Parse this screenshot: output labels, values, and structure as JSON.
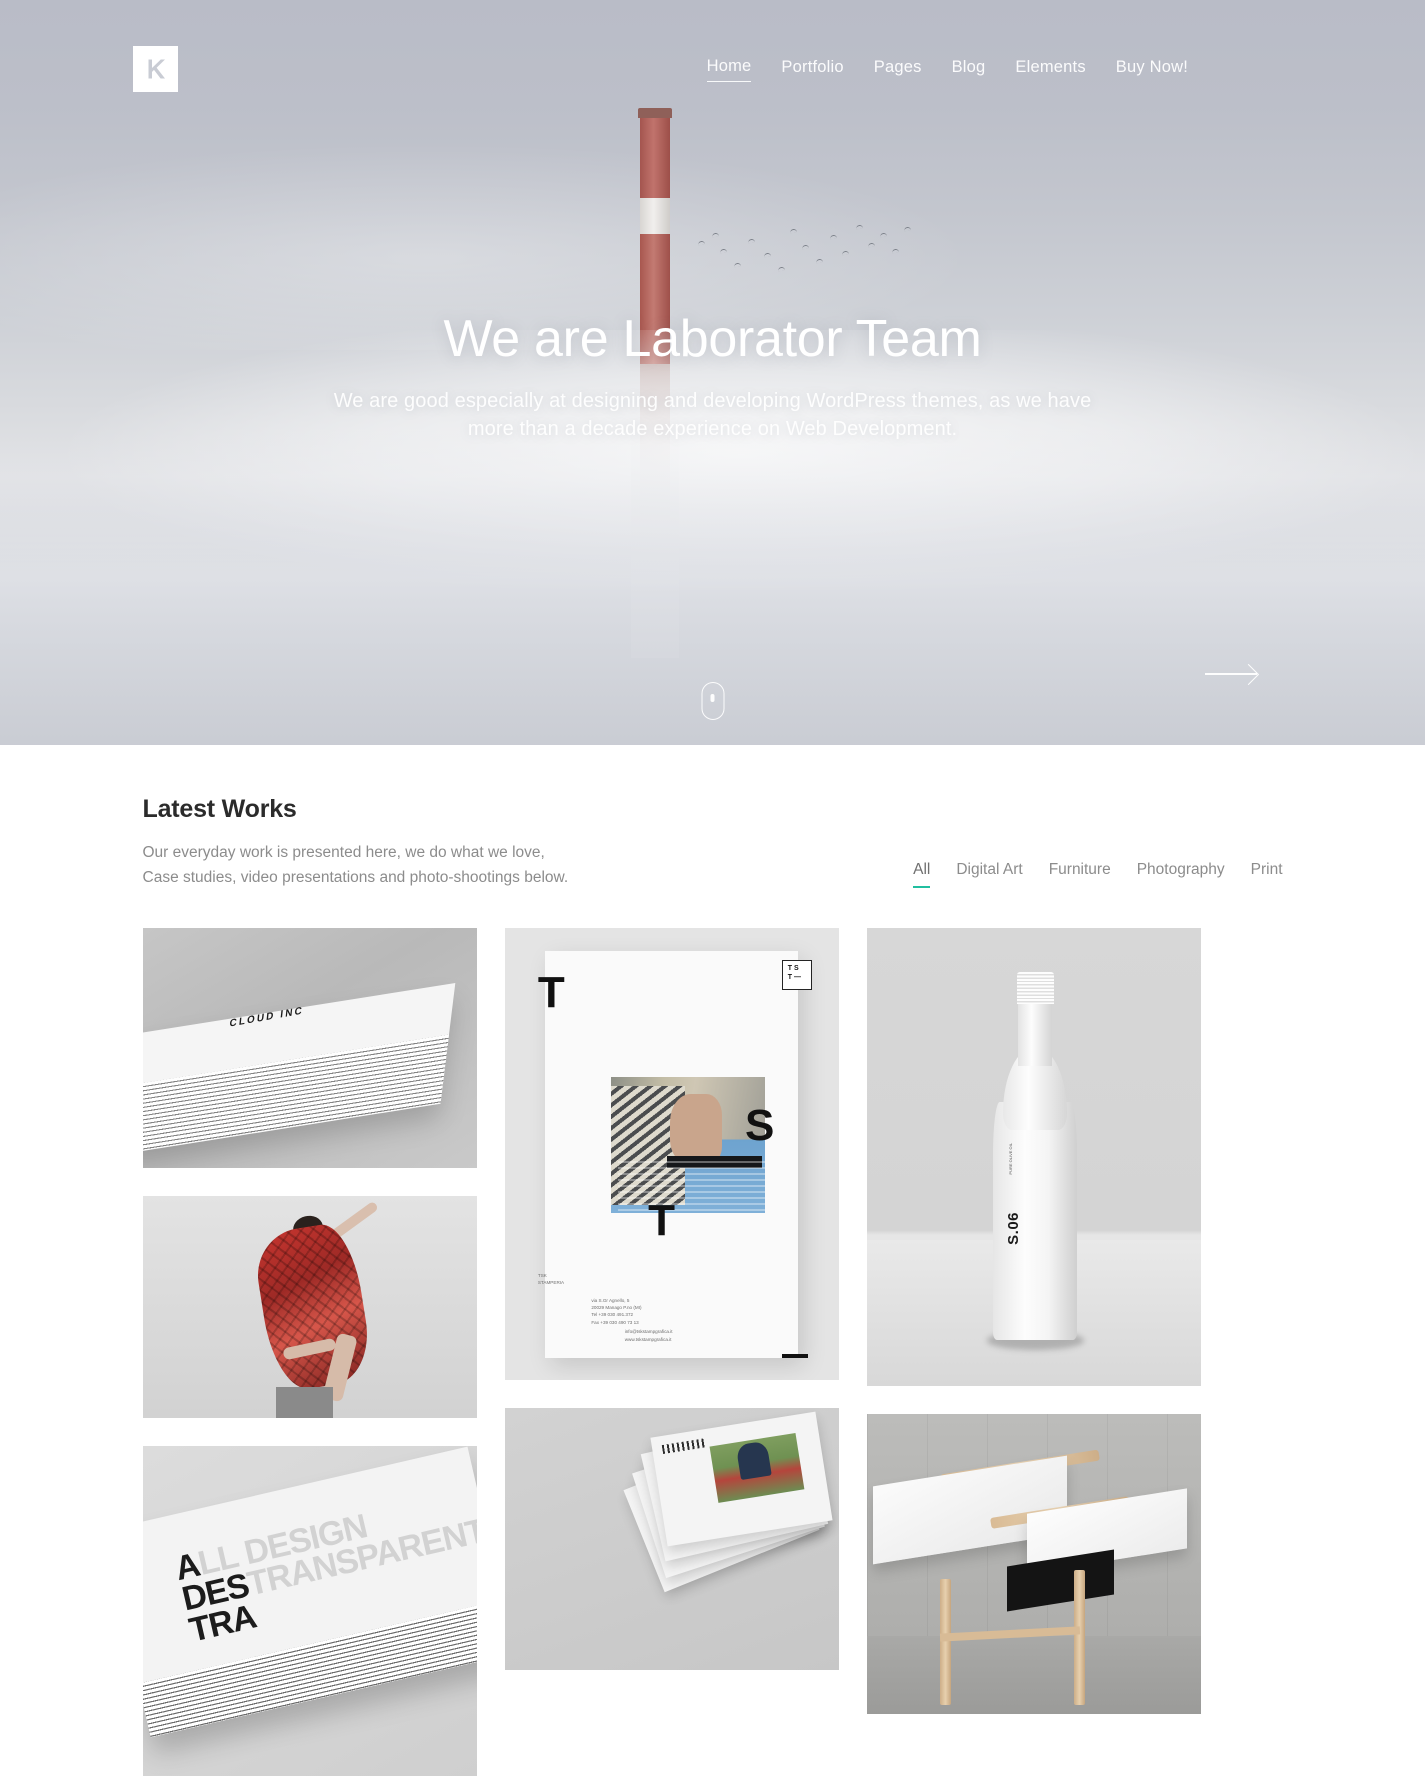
{
  "header": {
    "logo_alt": "K",
    "nav": [
      {
        "label": "Home",
        "active": true
      },
      {
        "label": "Portfolio",
        "active": false
      },
      {
        "label": "Pages",
        "active": false
      },
      {
        "label": "Blog",
        "active": false
      },
      {
        "label": "Elements",
        "active": false
      },
      {
        "label": "Buy Now!",
        "active": false
      }
    ]
  },
  "hero": {
    "title": "We are Laborator Team",
    "subtitle_line1": "We are good especially at designing and developing WordPress themes, as we have",
    "subtitle_line2": "more than a decade experience on Web Development.",
    "scroll_indicator": "mouse-scroll-icon",
    "next_slide": "arrow-right-icon"
  },
  "works": {
    "title": "Latest Works",
    "description_line1": "Our everyday work is presented here, we do what we love,",
    "description_line2": "Case studies, video presentations and photo-shootings below.",
    "filters": [
      {
        "label": "All",
        "active": true
      },
      {
        "label": "Digital Art",
        "active": false
      },
      {
        "label": "Furniture",
        "active": false
      },
      {
        "label": "Photography",
        "active": false
      },
      {
        "label": "Print",
        "active": false
      }
    ],
    "items": [
      {
        "name": "business-card-stack",
        "caption": "CLOUD INC"
      },
      {
        "name": "dancer-red-dress",
        "caption": ""
      },
      {
        "name": "embossed-cards",
        "caption": "ALL DESIGN TRANSPARENT"
      },
      {
        "name": "typography-poster",
        "caption": "T S T"
      },
      {
        "name": "booklet-stack",
        "caption": ""
      },
      {
        "name": "white-bottle",
        "caption": "S.06"
      },
      {
        "name": "wooden-white-desk",
        "caption": ""
      }
    ]
  },
  "colors": {
    "accent": "#21bfa0",
    "heading": "#2b2b2b",
    "muted": "#8c8c8c",
    "hero_text": "#ffffff"
  },
  "poster": {
    "letter_1": "T",
    "letter_2": "S",
    "letter_3": "T",
    "stamp_line1": "T S",
    "stamp_line2": "T —",
    "micro_1": "TSK\nSTAMPERIA",
    "micro_2": "via S.Gr Agnello, 5\n20029 Manago P.no (MI)\nTel +39 030 491.372\nFax +39 030 490 73 13",
    "micro_3": "info@tskstampgrafica.it\nwww.tskstampgrafica.it"
  },
  "bottle": {
    "label": "S.06",
    "microlabel": "PURE OLIVE OIL"
  },
  "emboss": {
    "line1_dark": "A",
    "line1_ghost": "LL DESIGN",
    "line2_dark": "DES",
    "line2_ghost": "TRANSPARENT",
    "line3_dark": "TRA"
  }
}
